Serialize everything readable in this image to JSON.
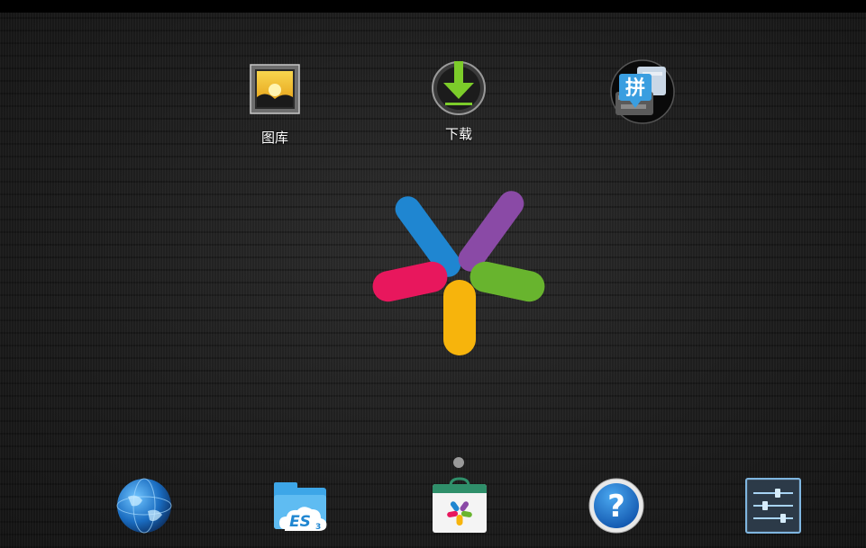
{
  "desktop": {
    "apps": [
      {
        "name": "gallery",
        "label": "图库",
        "icon": "gallery-icon"
      },
      {
        "name": "downloads",
        "label": "下载",
        "icon": "download-icon"
      },
      {
        "name": "pinyin-input",
        "label": "",
        "icon": "pinyin-keyboard-icon",
        "glyph": "拼"
      }
    ]
  },
  "logo": {
    "icon": "colorful-petal-logo",
    "colors": [
      "#1f86d1",
      "#8a4aa6",
      "#e8175d",
      "#68b42e",
      "#f7b40c"
    ]
  },
  "page_indicator": {
    "current": 1,
    "total": 1
  },
  "dock": {
    "items": [
      {
        "name": "browser",
        "icon": "globe-icon"
      },
      {
        "name": "es-file-explorer",
        "icon": "es-file-explorer-icon",
        "text": "ES",
        "sub": "3"
      },
      {
        "name": "app-store",
        "icon": "app-store-bag-icon"
      },
      {
        "name": "help",
        "icon": "help-icon",
        "glyph": "?"
      },
      {
        "name": "settings",
        "icon": "settings-sliders-icon"
      }
    ]
  }
}
